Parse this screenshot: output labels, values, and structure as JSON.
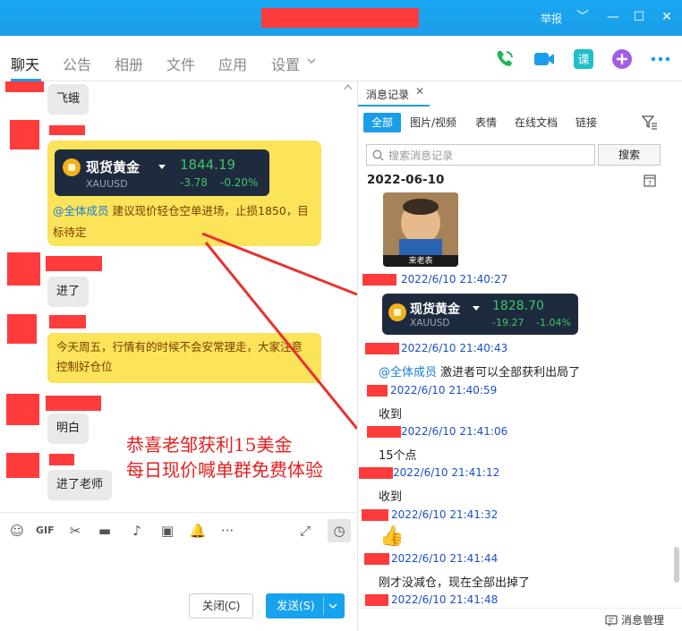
{
  "titlebar": {
    "report": "举报",
    "controls": [
      "﹀",
      "—",
      "☐",
      "✕"
    ]
  },
  "tabs": [
    "聊天",
    "公告",
    "相册",
    "文件",
    "应用",
    "设置"
  ],
  "chat": {
    "m1": "飞蛾",
    "ticker_left": {
      "name": "现货黄金",
      "symbol": "XAUUSD",
      "price": "1844.19",
      "change": "-3.78",
      "pct": "-0.20%"
    },
    "card_mention": "@全体成员",
    "card_text": "建议现价轻仓空单进场，止损1850，目标待定",
    "m2": "进了",
    "notice": "今天周五，行情有的时候不会安常理走，大家注意控制好仓位",
    "m3": "明白",
    "m4": "进了老师",
    "promo1": "恭喜老邹获利15美金",
    "promo2": "每日现价喊单群免费体验"
  },
  "footer": {
    "close": "关闭(C)",
    "send": "发送(S)"
  },
  "history": {
    "tab": "消息记录",
    "filters": [
      "全部",
      "图片/视频",
      "表情",
      "在线文档",
      "链接"
    ],
    "search_placeholder": "搜索消息记录",
    "search_btn": "搜索",
    "date": "2022-06-10",
    "sticker_caption": "来老表",
    "ticker": {
      "name": "现货黄金",
      "symbol": "XAUUSD",
      "price": "1828.70",
      "change": "-19.27",
      "pct": "-1.04%"
    },
    "t1": "2022/6/10 21:40:27",
    "t2": "2022/6/10 21:40:43",
    "mention": "@全体成员",
    "msg2": "激进者可以全部获利出局了",
    "t3": "2022/6/10 21:40:59",
    "msg3": "收到",
    "t4": "2022/6/10 21:41:06",
    "msg4": "15个点",
    "t5": "2022/6/10 21:41:12",
    "msg5": "收到",
    "t6": "2022/6/10 21:41:32",
    "msg6": "👍",
    "t7": "2022/6/10 21:41:44",
    "msg7": "刚才没减仓，现在全部出掉了",
    "t8": "2022/6/10 21:41:48",
    "manage": "消息管理"
  },
  "colors": {
    "accent": "#1b9ee9",
    "redact": "#ff3b3b",
    "gold": "#fbe35a",
    "green": "#3ec46d"
  }
}
